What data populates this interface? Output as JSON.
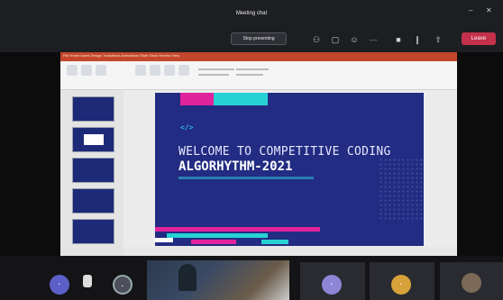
{
  "window": {
    "title": "Meeting chat",
    "minimize_glyph": "–",
    "close_glyph": "✕"
  },
  "toolbar": {
    "stop_sharing_label": "Stop presenting",
    "leave_label": "Leave",
    "icons": [
      "people-icon",
      "chat-icon",
      "reactions-icon",
      "more-icon",
      "camera-icon",
      "mic-icon",
      "share-icon"
    ]
  },
  "ppt": {
    "tabs": "File   Home   Insert   Design   Transitions   Animations   Slide Show   Review   View"
  },
  "slide": {
    "code_icon": "</>",
    "title": "WELCOME TO COMPETITIVE CODING",
    "subtitle": "ALGORHYTHM-2021",
    "colors": {
      "background": "#222c82",
      "accent_cyan": "#28d1d3",
      "accent_pink": "#e0249c"
    }
  },
  "participants": {
    "avatar_1_initial": "·",
    "avatar_2_initial": "·",
    "avatar_3_initial": "·",
    "avatar_4_initial": "·"
  }
}
